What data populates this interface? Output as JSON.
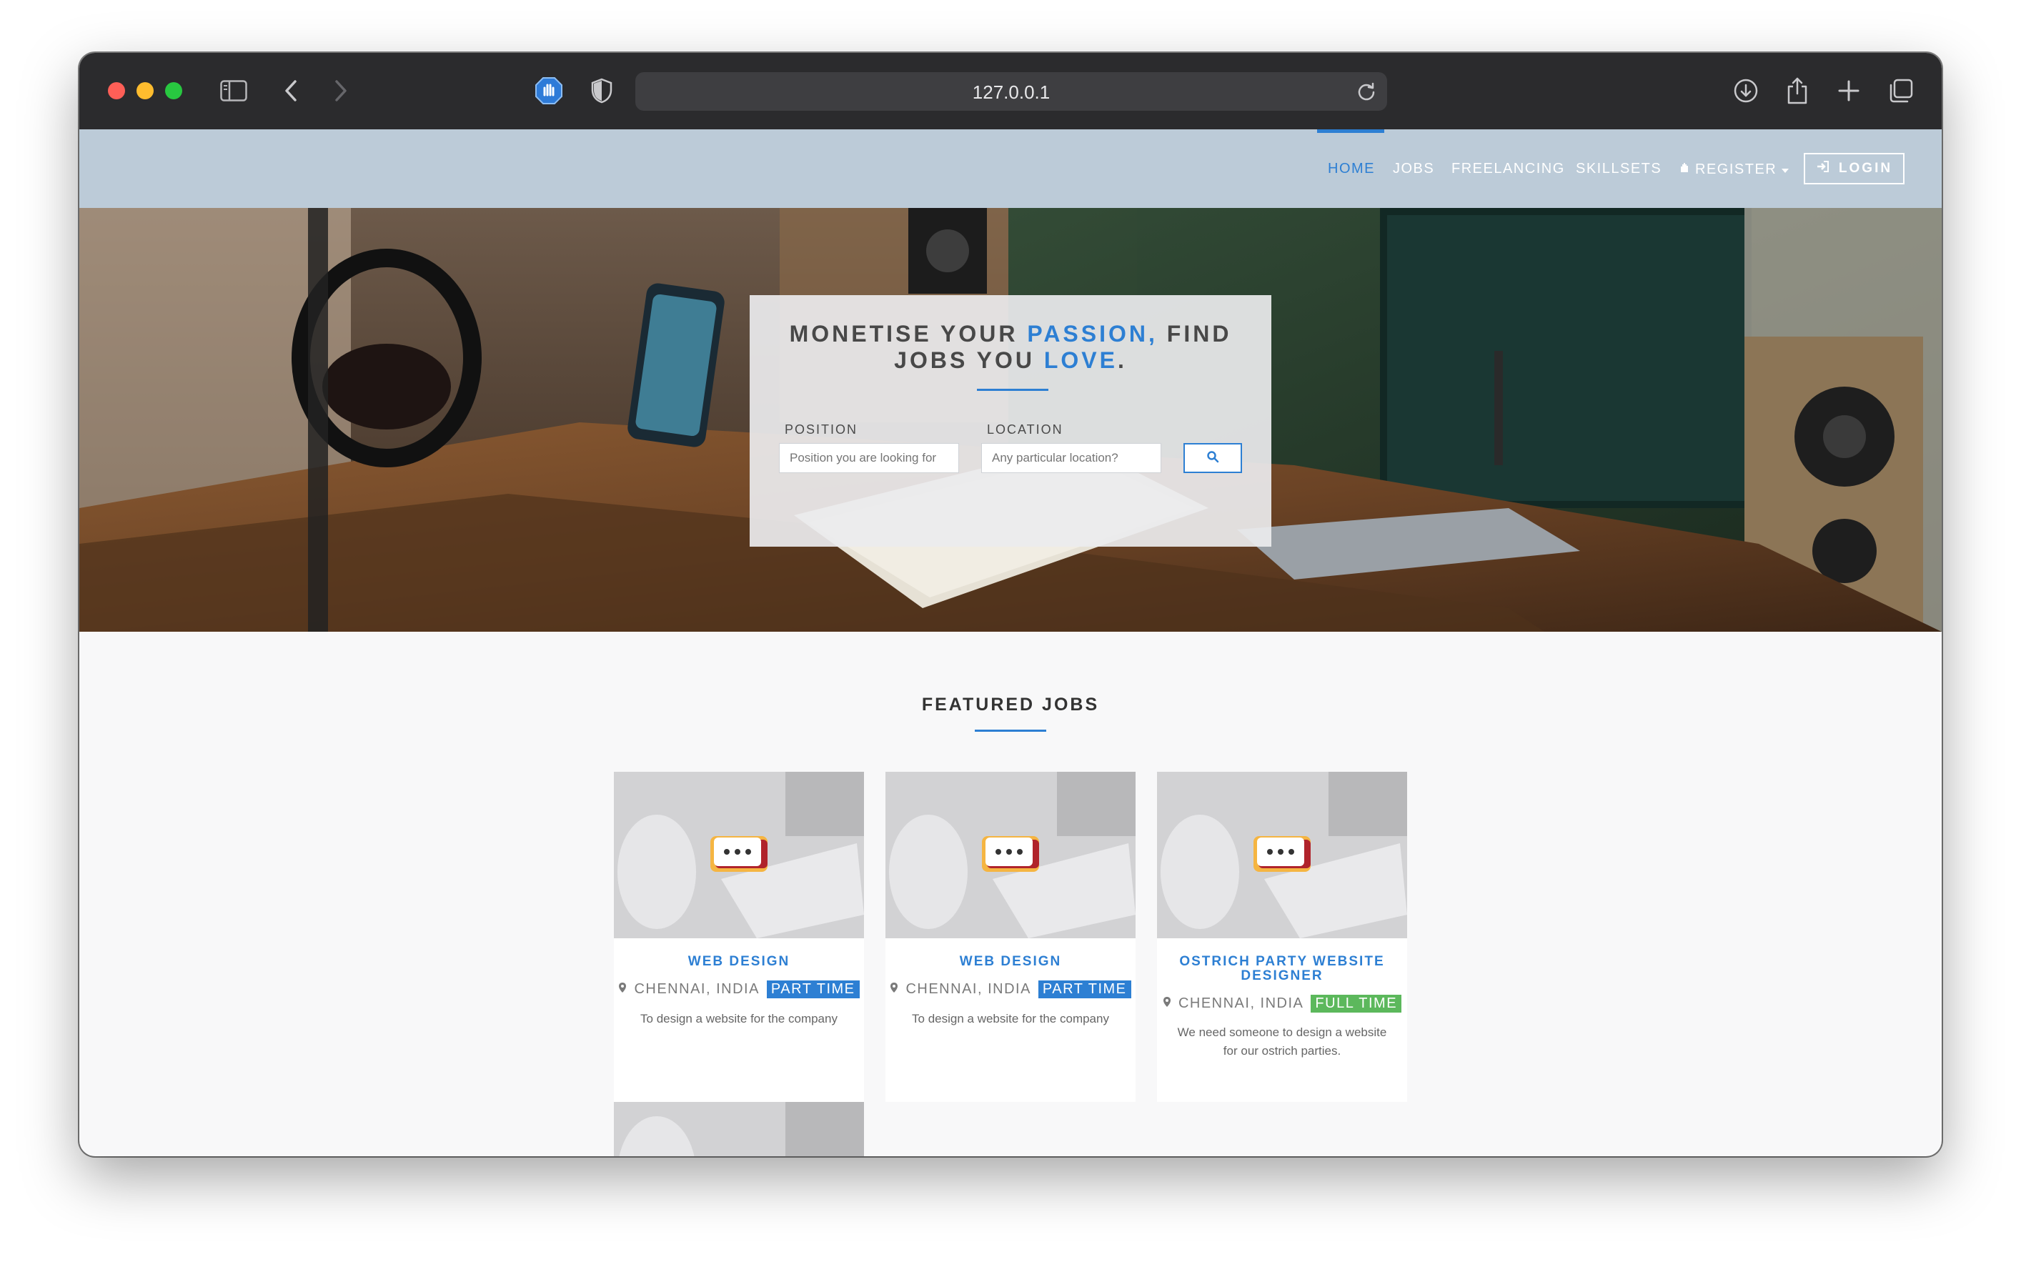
{
  "browser": {
    "url": "127.0.0.1"
  },
  "nav": {
    "items": [
      {
        "label": "HOME",
        "active": true
      },
      {
        "label": "JOBS",
        "active": false
      },
      {
        "label": "FREELANCING",
        "active": false
      },
      {
        "label": "SKILLSETS",
        "active": false
      }
    ],
    "register_label": "REGISTER",
    "login_label": "LOGIN"
  },
  "hero": {
    "title_line1_a": "MONETISE YOUR ",
    "title_line1_b": "PASSION,",
    "title_line1_c": " FIND",
    "title_line2_a": "JOBS YOU ",
    "title_line2_b": "LOVE",
    "title_line2_c": ".",
    "position_label": "POSITION",
    "position_placeholder": "Position you are looking for",
    "location_label": "LOCATION",
    "location_placeholder": "Any particular location?"
  },
  "featured": {
    "title": "FEATURED JOBS",
    "jobs": [
      {
        "title": "WEB DESIGN",
        "location": "CHENNAI, INDIA",
        "type": "PART TIME",
        "type_color": "#2d7fd3",
        "description": "To design a website for the company"
      },
      {
        "title": "WEB DESIGN",
        "location": "CHENNAI, INDIA",
        "type": "PART TIME",
        "type_color": "#2d7fd3",
        "description": "To design a website for the company"
      },
      {
        "title": "OSTRICH PARTY WEBSITE DESIGNER",
        "location": "CHENNAI, INDIA",
        "type": "FULL TIME",
        "type_color": "#5cb85c",
        "description": "We need someone to design a website for our ostrich parties."
      }
    ]
  },
  "colors": {
    "accent": "#2d7fd3",
    "full_time": "#5cb85c",
    "navbar": "#bccbd8"
  }
}
